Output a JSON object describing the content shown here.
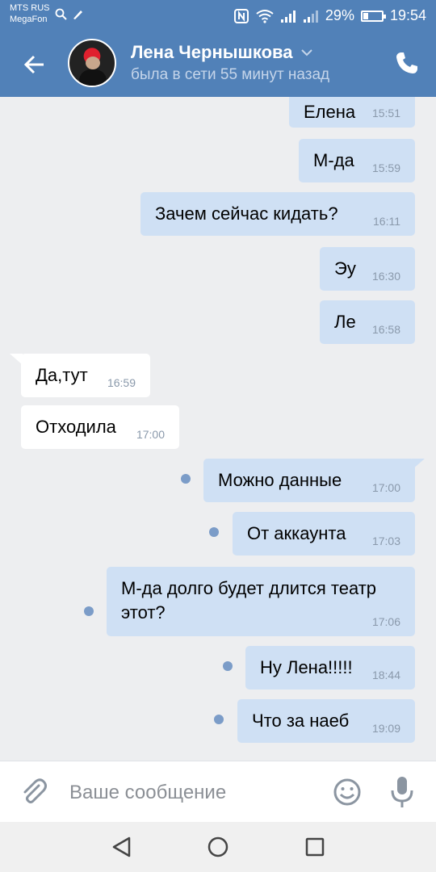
{
  "status_bar": {
    "carrier_line1": "MTS RUS",
    "carrier_line2": "MegaFon",
    "battery_percent": "29%",
    "battery_level": 0.29,
    "time": "19:54"
  },
  "header": {
    "contact_name": "Лена Чернышкова",
    "contact_status": "была в сети 55 минут назад"
  },
  "messages": [
    {
      "direction": "out",
      "text": "Елена",
      "time": "15:51",
      "unread": false
    },
    {
      "direction": "out",
      "text": "М-да",
      "time": "15:59",
      "unread": false
    },
    {
      "direction": "out",
      "text": "Зачем сейчас кидать?",
      "time": "16:11",
      "unread": false
    },
    {
      "direction": "out",
      "text": "Эу",
      "time": "16:30",
      "unread": false
    },
    {
      "direction": "out",
      "text": "Ле",
      "time": "16:58",
      "unread": false
    },
    {
      "direction": "in",
      "text": "Да,тут",
      "time": "16:59",
      "unread": false
    },
    {
      "direction": "in",
      "text": "Отходила",
      "time": "17:00",
      "unread": false
    },
    {
      "direction": "out",
      "text": "Можно данные",
      "time": "17:00",
      "unread": true
    },
    {
      "direction": "out",
      "text": "От аккаунта",
      "time": "17:03",
      "unread": true
    },
    {
      "direction": "out",
      "text": "М-да долго будет длится театр\nэтот?",
      "time": "17:06",
      "unread": true
    },
    {
      "direction": "out",
      "text": "Ну Лена!!!!!",
      "time": "18:44",
      "unread": true
    },
    {
      "direction": "out",
      "text": "Что за наеб",
      "time": "19:09",
      "unread": true
    }
  ],
  "composer": {
    "placeholder": "Ваше сообщение"
  },
  "icons": {
    "back": "arrow-left-icon",
    "call": "phone-icon",
    "attach": "paperclip-icon",
    "emoji": "smiley-icon",
    "mic": "microphone-icon",
    "nav_back": "triangle-back-icon",
    "nav_home": "circle-home-icon",
    "nav_recent": "square-recent-icon"
  },
  "colors": {
    "header": "#5181b8",
    "outgoing_bubble": "#cfe0f4",
    "incoming_bubble": "#ffffff",
    "chat_bg": "#edeef0",
    "unread_dot": "#7b9cc8"
  }
}
